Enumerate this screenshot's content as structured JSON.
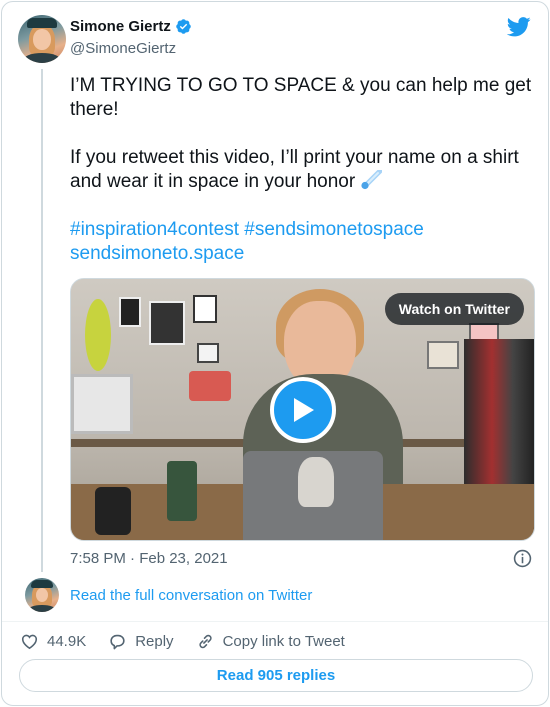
{
  "author": {
    "name": "Simone Giertz",
    "handle": "@SimoneGiertz",
    "verified": true
  },
  "tweet": {
    "paragraph1": "I’M TRYING TO GO TO SPACE & you can help me get there!",
    "paragraph2": "If you retweet this video, I’ll print your name on a shirt and wear it in space in your honor",
    "emoji": "comet-emoji",
    "hashtag1": "#inspiration4contest",
    "hashtag2": "#sendsimonetospace",
    "url": "sendsimoneto.space"
  },
  "media": {
    "type": "video",
    "watch_label": "Watch on Twitter"
  },
  "timestamp": "7:58 PM · Feb 23, 2021",
  "read_conversation": "Read the full conversation on Twitter",
  "actions": {
    "likes": "44.9K",
    "reply_label": "Reply",
    "copy_label": "Copy link to Tweet"
  },
  "read_replies": "Read 905 replies",
  "colors": {
    "accent": "#1d9bf0",
    "text": "#0f1419",
    "secondary": "#536471",
    "border": "#cfd9de"
  },
  "icons": [
    "verified-badge-icon",
    "twitter-bird-icon",
    "play-icon",
    "info-icon",
    "heart-icon",
    "reply-icon",
    "link-icon"
  ]
}
